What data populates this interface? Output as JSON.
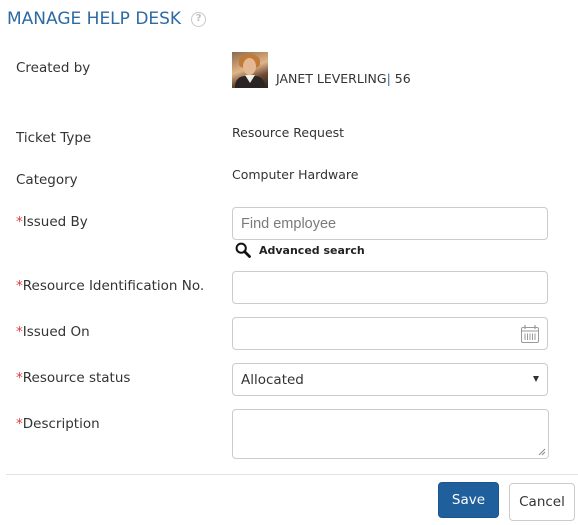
{
  "header": {
    "title": "MANAGE HELP DESK",
    "help_icon": "question-circle-icon"
  },
  "form": {
    "created_by": {
      "label": "Created by",
      "name": "JANET LEVERLING",
      "separator": "|",
      "id": "56"
    },
    "ticket_type": {
      "label": "Ticket Type",
      "value": "Resource Request"
    },
    "category": {
      "label": "Category",
      "value": "Computer Hardware"
    },
    "issued_by": {
      "required_marker": "*",
      "label": "Issued By",
      "placeholder": "Find employee",
      "value": "",
      "advanced_search_label": "Advanced search"
    },
    "resource_id": {
      "required_marker": "*",
      "label": "Resource Identification No.",
      "value": ""
    },
    "issued_on": {
      "required_marker": "*",
      "label": "Issued On",
      "value": "",
      "icon": "calendar-icon"
    },
    "resource_status": {
      "required_marker": "*",
      "label": "Resource status",
      "selected": "Allocated"
    },
    "description": {
      "required_marker": "*",
      "label": "Description",
      "value": ""
    }
  },
  "actions": {
    "save_label": "Save",
    "cancel_label": "Cancel"
  },
  "colors": {
    "title": "#2d6aa3",
    "required": "#e0393e",
    "primary_button": "#1f5f9c"
  }
}
